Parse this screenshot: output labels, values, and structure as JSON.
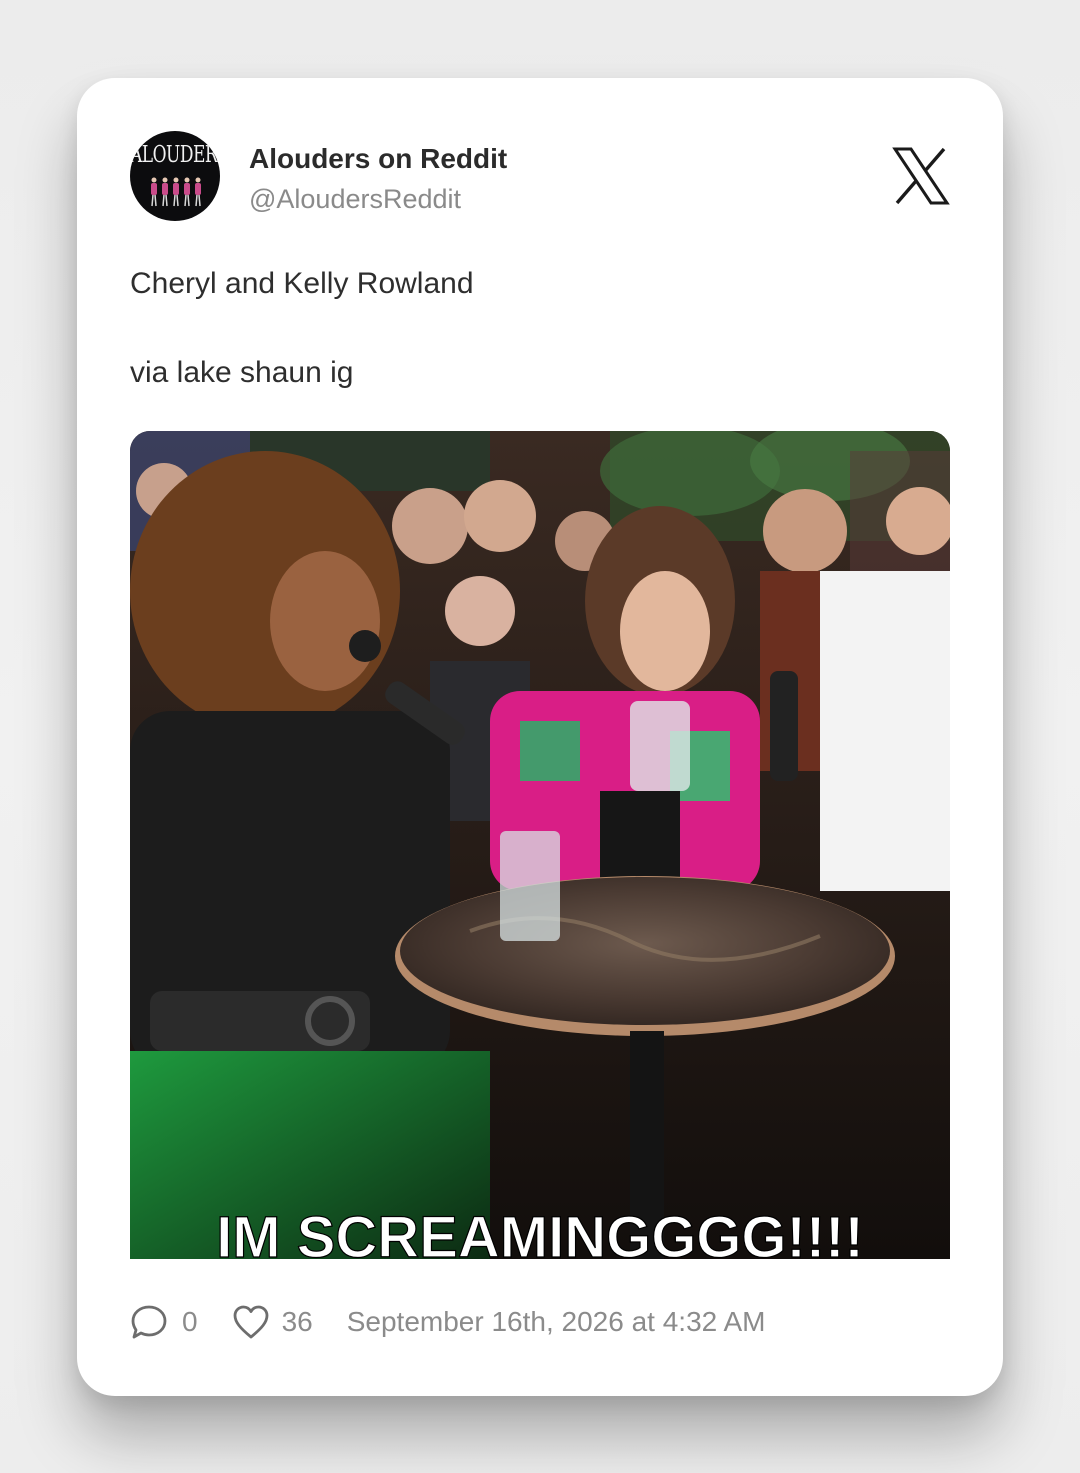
{
  "author": {
    "display_name": "Alouders on Reddit",
    "handle": "@AloudersReddit",
    "avatar_text": "ALOUDERS"
  },
  "platform_icon": "x-logo-icon",
  "tweet": {
    "line1": "Cheryl and Kelly Rowland",
    "line2": "via lake shaun ig"
  },
  "media": {
    "caption": "IM SCREAMINGGGG!!!!",
    "description_icon": "photo"
  },
  "footer": {
    "reply_icon": "speech-bubble-icon",
    "reply_count": "0",
    "like_icon": "heart-icon",
    "like_count": "36",
    "timestamp": "September 16th, 2026 at 4:32 AM"
  },
  "colors": {
    "card": "#ffffff",
    "name": "#2b2b2b",
    "muted": "#8b8b8b",
    "text": "#2e2e2e"
  }
}
